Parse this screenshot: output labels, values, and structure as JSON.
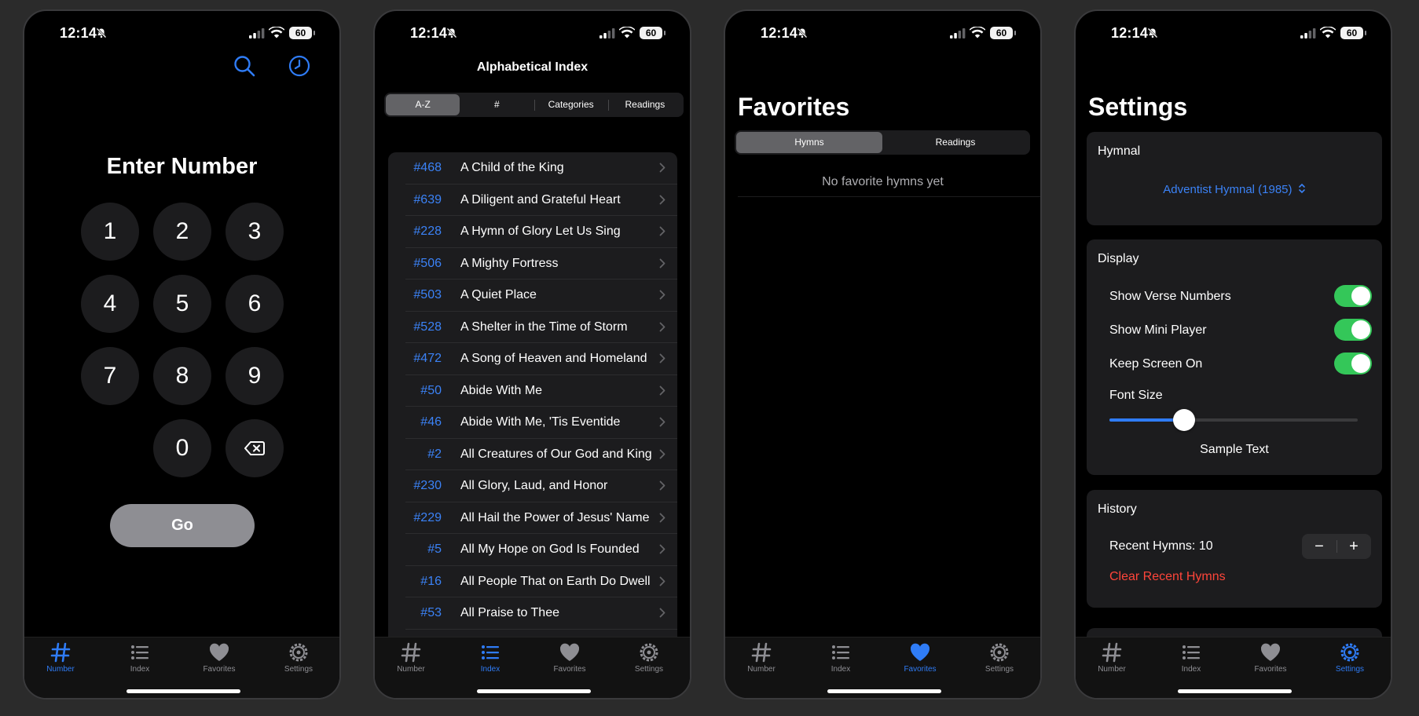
{
  "status_bar": {
    "time": "12:14",
    "battery": "60"
  },
  "tabs": [
    {
      "label": "Number",
      "icon": "hash-icon"
    },
    {
      "label": "Index",
      "icon": "list-icon"
    },
    {
      "label": "Favorites",
      "icon": "heart-icon"
    },
    {
      "label": "Settings",
      "icon": "gear-icon"
    }
  ],
  "number_screen": {
    "title": "Enter Number",
    "keys": [
      "1",
      "2",
      "3",
      "4",
      "5",
      "6",
      "7",
      "8",
      "9",
      "0"
    ],
    "go_label": "Go"
  },
  "index_screen": {
    "title": "Alphabetical Index",
    "segments": [
      "A-Z",
      "#",
      "Categories",
      "Readings"
    ],
    "selected_segment": "A-Z",
    "hymns": [
      {
        "number": "#468",
        "title": "A Child of the King"
      },
      {
        "number": "#639",
        "title": "A Diligent and Grateful Heart"
      },
      {
        "number": "#228",
        "title": "A Hymn of Glory Let Us Sing"
      },
      {
        "number": "#506",
        "title": "A Mighty Fortress"
      },
      {
        "number": "#503",
        "title": "A Quiet Place"
      },
      {
        "number": "#528",
        "title": "A Shelter in the Time of Storm"
      },
      {
        "number": "#472",
        "title": "A Song of Heaven and Homeland"
      },
      {
        "number": "#50",
        "title": "Abide With Me"
      },
      {
        "number": "#46",
        "title": "Abide With Me, 'Tis Eventide"
      },
      {
        "number": "#2",
        "title": "All Creatures of Our God and King"
      },
      {
        "number": "#230",
        "title": "All Glory, Laud, and Honor"
      },
      {
        "number": "#229",
        "title": "All Hail the Power of Jesus' Name"
      },
      {
        "number": "#5",
        "title": "All My Hope on God Is Founded"
      },
      {
        "number": "#16",
        "title": "All People That on Earth Do Dwell"
      },
      {
        "number": "#53",
        "title": "All Praise to Thee"
      }
    ]
  },
  "favorites_screen": {
    "title": "Favorites",
    "segments": [
      "Hymns",
      "Readings"
    ],
    "selected_segment": "Hymns",
    "empty_text": "No favorite hymns yet"
  },
  "settings_screen": {
    "title": "Settings",
    "hymnal": {
      "header": "Hymnal",
      "value": "Adventist Hymnal (1985)"
    },
    "display": {
      "header": "Display",
      "toggles": [
        {
          "label": "Show Verse Numbers",
          "on": true
        },
        {
          "label": "Show Mini Player",
          "on": true
        },
        {
          "label": "Keep Screen On",
          "on": true
        }
      ],
      "font_size_label": "Font Size",
      "font_size_fraction": 0.3,
      "sample_text": "Sample Text"
    },
    "history": {
      "header": "History",
      "recent_label": "Recent Hymns: 10",
      "minus": "−",
      "plus": "+",
      "clear_label": "Clear Recent Hymns"
    }
  },
  "colors": {
    "accent": "#2f7cf6",
    "toggle_on": "#34c759",
    "danger": "#ff453a",
    "background": "#000000"
  }
}
